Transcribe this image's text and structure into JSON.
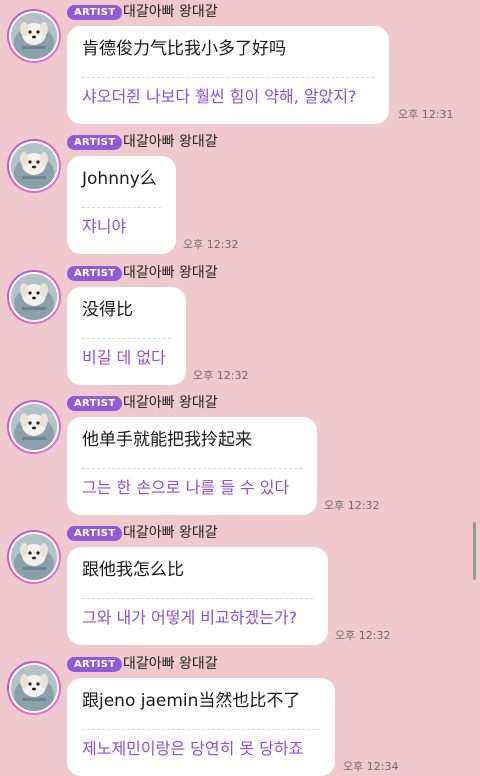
{
  "messages": [
    {
      "badge": "ARTIST",
      "sender": "대갈아빠 왕대갈",
      "original": "肯德俊力气比我小多了好吗",
      "translation": "샤오더쥔 나보다 훨씬 힘이 약해, 알았지?",
      "time": "오후 12:31"
    },
    {
      "badge": "ARTIST",
      "sender": "대갈아빠 왕대갈",
      "original": "Johnny么",
      "translation": "쟈니야",
      "time": "오후 12:32"
    },
    {
      "badge": "ARTIST",
      "sender": "대갈아빠 왕대갈",
      "original": "没得比",
      "translation": "비길 데 없다",
      "time": "오후 12:32"
    },
    {
      "badge": "ARTIST",
      "sender": "대갈아빠 왕대갈",
      "original": "他单手就能把我拎起来",
      "translation": "그는 한 손으로 나를 들 수 있다",
      "time": "오후 12:32"
    },
    {
      "badge": "ARTIST",
      "sender": "대갈아빠 왕대갈",
      "original": "跟他我怎么比",
      "translation": "그와 내가 어떻게 비교하겠는가?",
      "time": "오후 12:32"
    },
    {
      "badge": "ARTIST",
      "sender": "대갈아빠 왕대갈",
      "original": "跟jeno jaemin当然也比不了",
      "translation": "제노제민이랑은 당연히 못 당하죠",
      "time": "오후 12:34"
    }
  ],
  "icons": {
    "avatar": "dog-avatar-icon"
  },
  "colors": {
    "background": "#f0c9cf",
    "badge": "#8f5bd9",
    "translation": "#8f4fd8",
    "bubble": "#ffffff"
  }
}
